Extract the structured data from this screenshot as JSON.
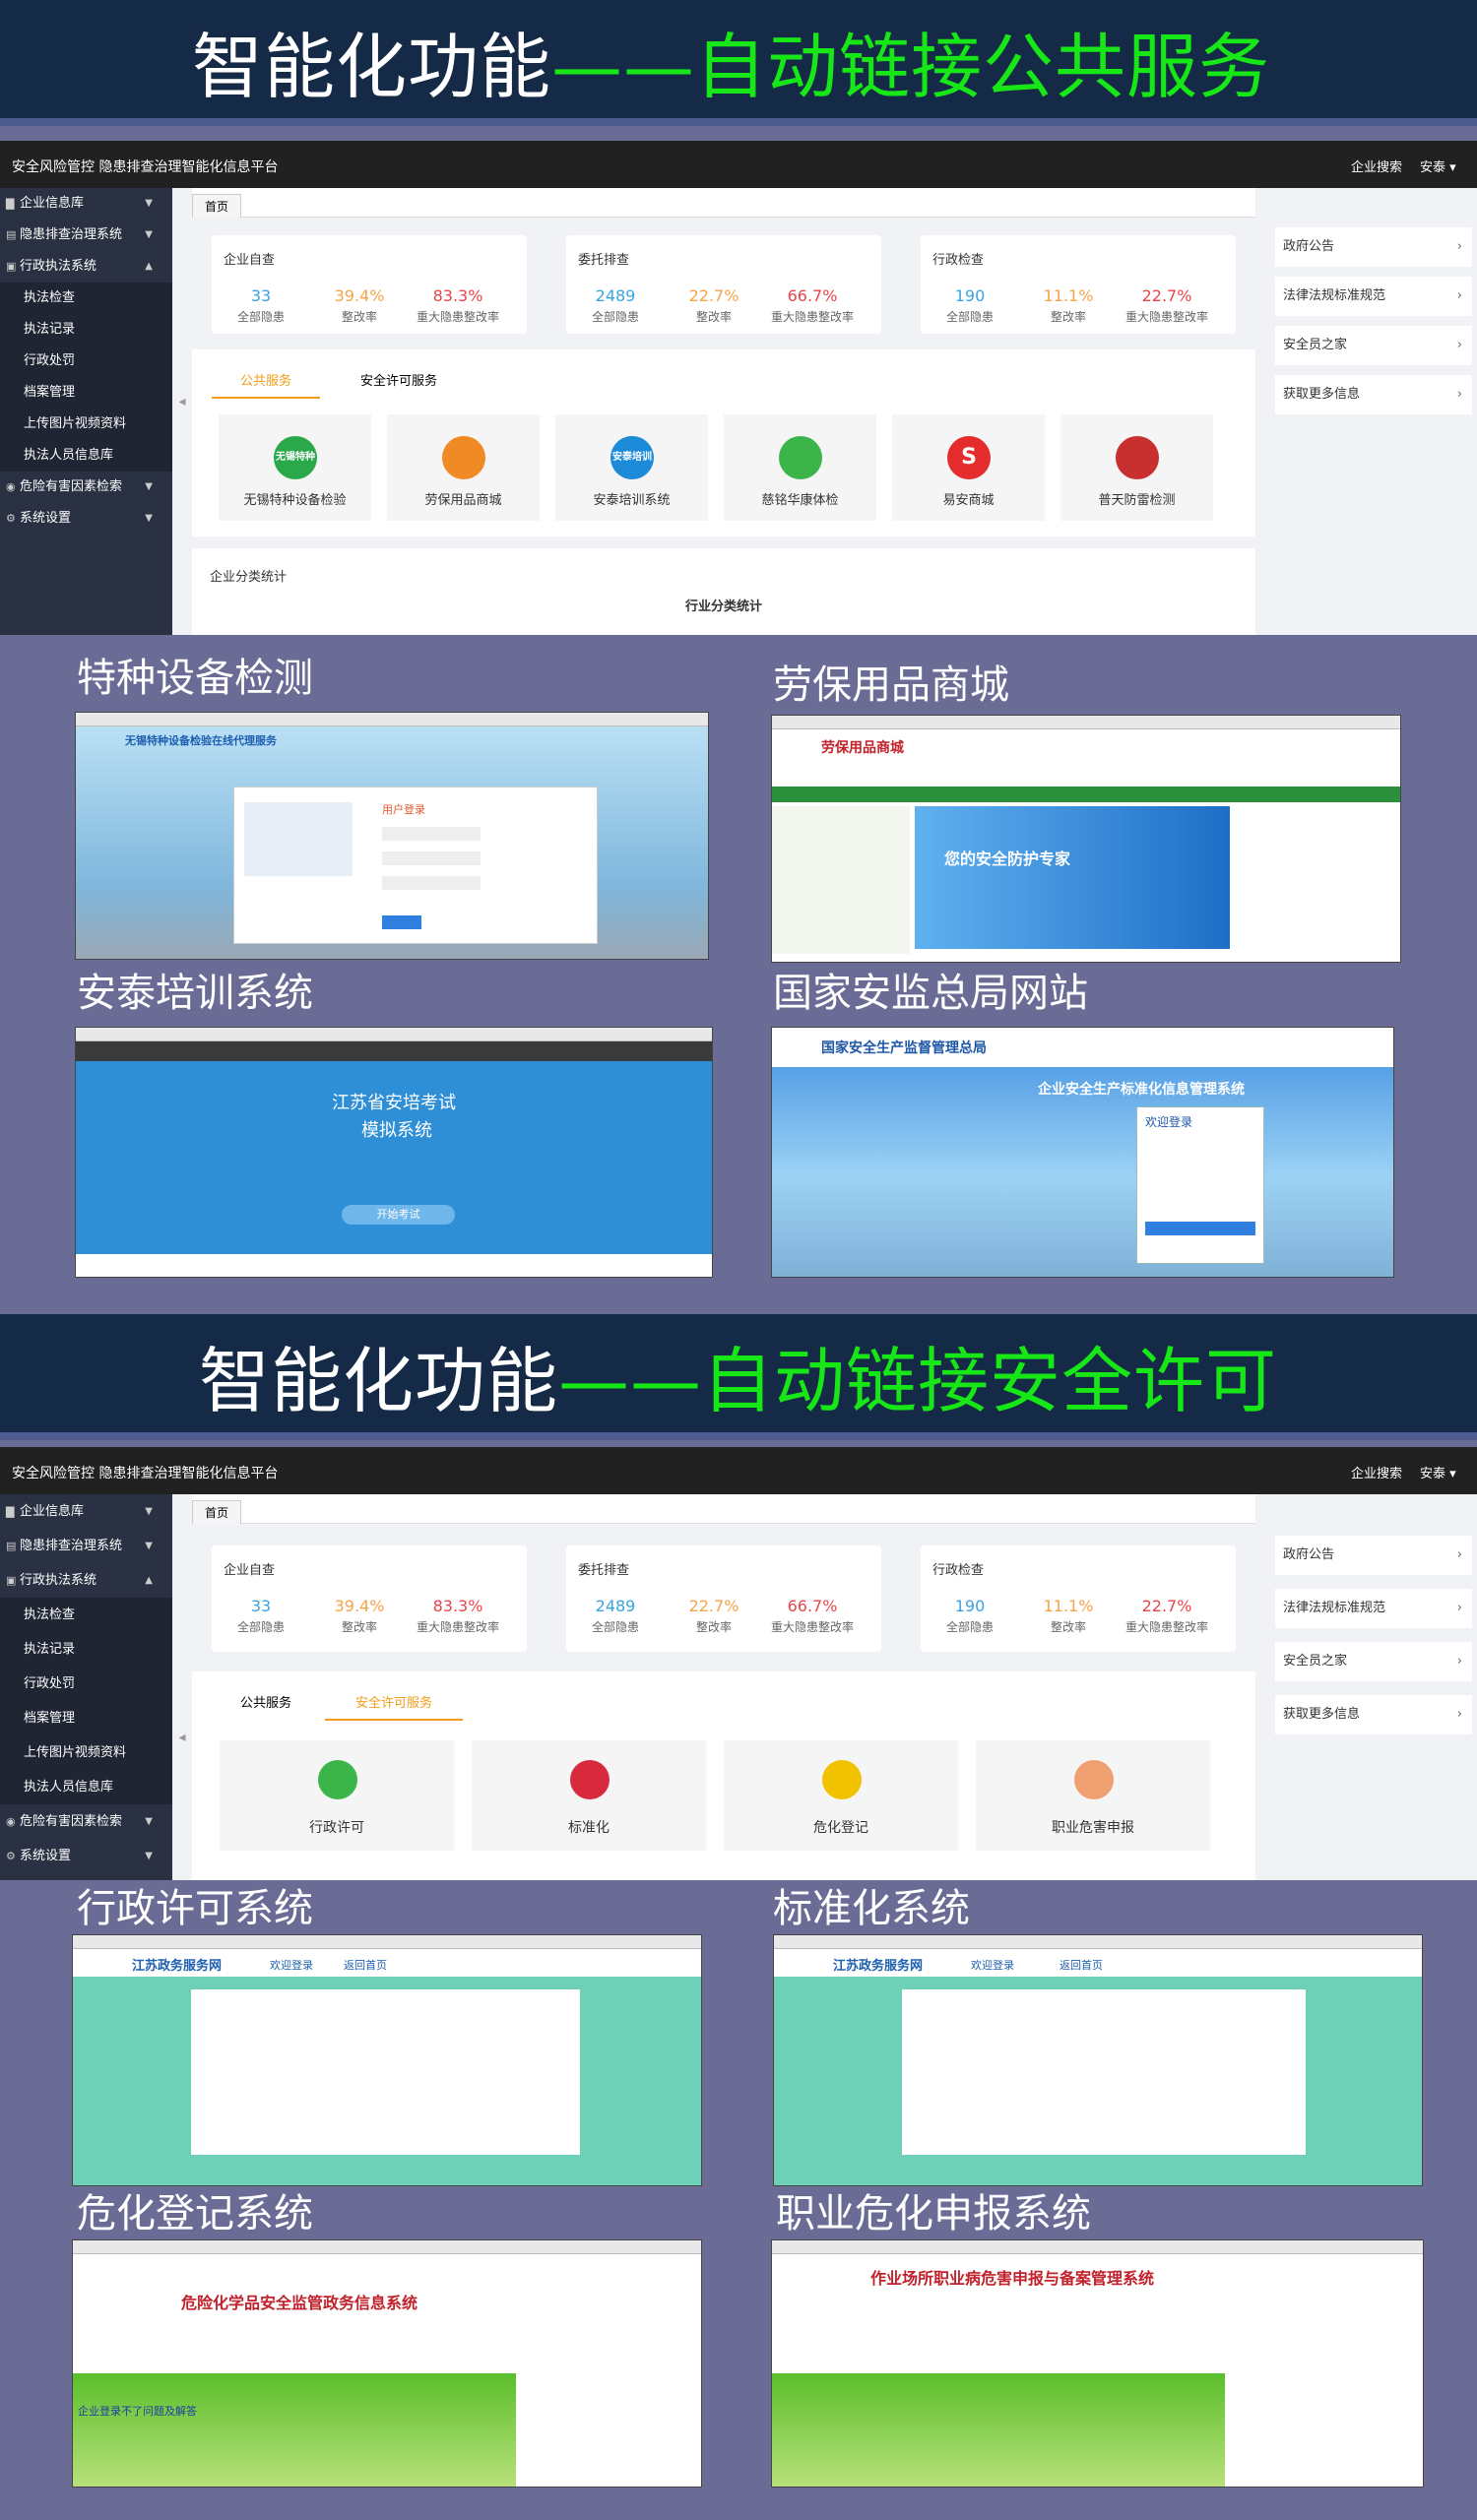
{
  "banner1": {
    "white": "智能化功能",
    "green": "——自动链接公共服务"
  },
  "banner2": {
    "white": "智能化功能",
    "green": "——自动链接安全许可"
  },
  "app": {
    "title": "安全风险管控 隐患排查治理智能化信息平台",
    "search": "企业搜索",
    "user": "安泰",
    "tab": "首页",
    "sidebar": [
      {
        "label": "企业信息库",
        "icon": "building-icon"
      },
      {
        "label": "隐患排查治理系统",
        "icon": "document-icon"
      },
      {
        "label": "行政执法系统",
        "icon": "gavel-icon"
      },
      {
        "label": "执法检查"
      },
      {
        "label": "执法记录"
      },
      {
        "label": "行政处罚"
      },
      {
        "label": "档案管理"
      },
      {
        "label": "上传图片视频资料"
      },
      {
        "label": "执法人员信息库"
      },
      {
        "label": "危险有害因素检索",
        "icon": "warning-icon"
      },
      {
        "label": "系统设置",
        "icon": "gear-icon"
      }
    ],
    "stats": [
      {
        "title": "企业自查",
        "v1": "33",
        "l1": "全部隐患",
        "v2": "39.4%",
        "l2": "整改率",
        "v3": "83.3%",
        "l3": "重大隐患整改率"
      },
      {
        "title": "委托排查",
        "v1": "2489",
        "l1": "全部隐患",
        "v2": "22.7%",
        "l2": "整改率",
        "v3": "66.7%",
        "l3": "重大隐患整改率"
      },
      {
        "title": "行政检查",
        "v1": "190",
        "l1": "全部隐患",
        "v2": "11.1%",
        "l2": "整改率",
        "v3": "22.7%",
        "l3": "重大隐患整改率"
      }
    ],
    "tabs": [
      "公共服务",
      "安全许可服务"
    ],
    "services": [
      {
        "name": "无锡特种设备检验",
        "badge": "无锡特种设备",
        "color": "#2ba84a"
      },
      {
        "name": "劳保用品商城",
        "badge": "",
        "color": "#f08a24"
      },
      {
        "name": "安泰培训系统",
        "badge": "安泰培训",
        "color": "#1d8bd8"
      },
      {
        "name": "慈铭华康体检",
        "badge": "",
        "color": "#3bb54a"
      },
      {
        "name": "易安商城",
        "badge": "S",
        "color": "#e42c2c"
      },
      {
        "name": "普天防雷检测",
        "badge": "",
        "color": "#c8302f"
      }
    ],
    "licenses": [
      {
        "name": "行政许可",
        "color": "#3bb54a"
      },
      {
        "name": "标准化",
        "color": "#d92a3d"
      },
      {
        "name": "危化登记",
        "color": "#f2c200"
      },
      {
        "name": "职业危害申报",
        "color": "#f0a070"
      }
    ],
    "classify_title": "企业分类统计",
    "classify_chart": "行业分类统计",
    "right_links": [
      "政府公告",
      "法律法规标准规范",
      "安全员之家",
      "获取更多信息"
    ]
  },
  "shots1": [
    {
      "label": "特种设备检测",
      "line1": "无锡特种设备检验在线代理服务",
      "line2": "用户登录"
    },
    {
      "label": "劳保用品商城",
      "line1": "劳保用品商城",
      "line2": "您的安全防护专家"
    },
    {
      "label": "安泰培训系统",
      "line1": "江苏省安培考试",
      "line2": "模拟系统",
      "button": "开始考试"
    },
    {
      "label": "国家安监总局网站",
      "line1": "国家安全生产监督管理总局",
      "line2": "企业安全生产标准化信息管理系统",
      "line3": "欢迎登录"
    }
  ],
  "shots2": [
    {
      "label": "行政许可系统",
      "line1": "江苏政务服务网",
      "line2": "欢迎登录",
      "line3": "返回首页"
    },
    {
      "label": "标准化系统",
      "line1": "江苏政务服务网",
      "line2": "欢迎登录",
      "line3": "返回首页"
    },
    {
      "label": "危化登记系统",
      "line1": "危险化学品安全监管政务信息系统",
      "line2": "企业登录不了问题及解答"
    },
    {
      "label": "职业危化申报系统",
      "line1": "作业场所职业病危害申报与备案管理系统"
    }
  ]
}
